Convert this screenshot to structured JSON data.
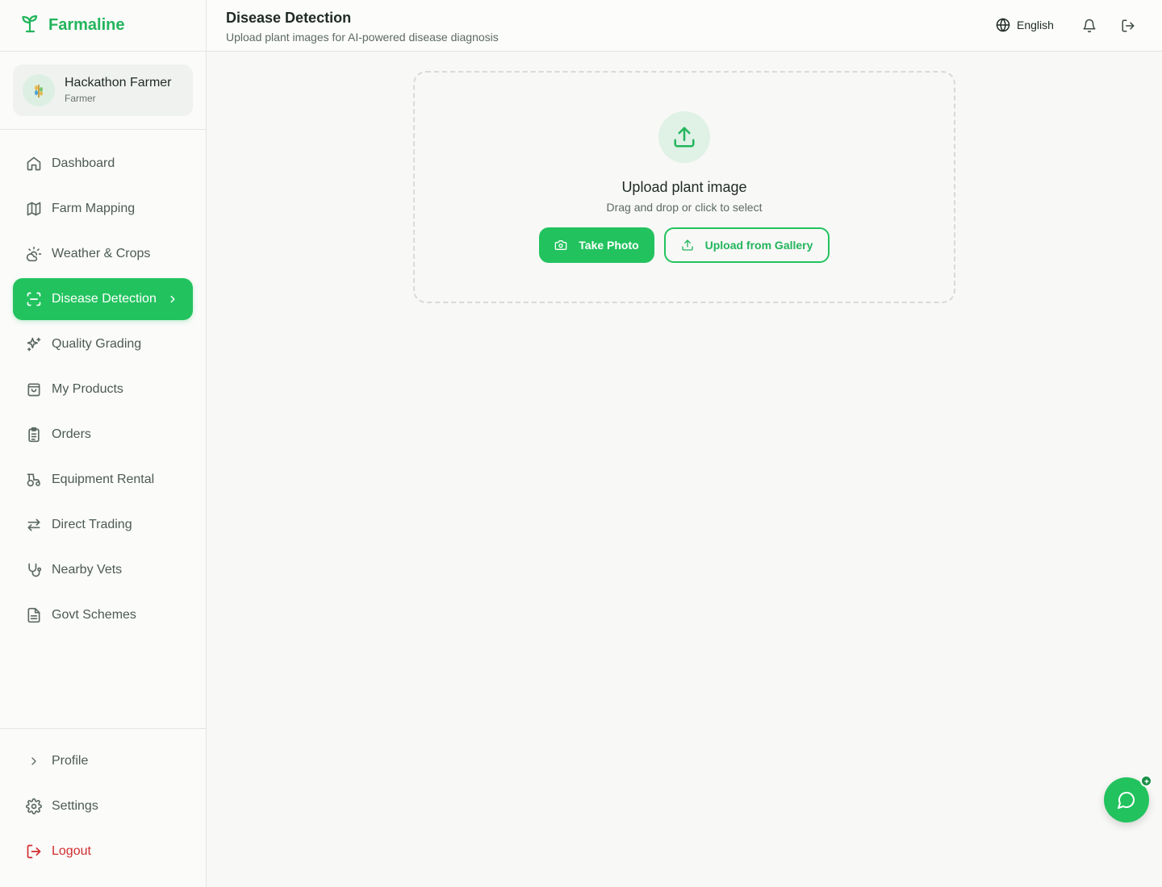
{
  "app": {
    "name": "Farmaline"
  },
  "user": {
    "name": "Hackathon Farmer",
    "role": "Farmer"
  },
  "nav": {
    "items": [
      {
        "label": "Dashboard",
        "icon": "home-icon"
      },
      {
        "label": "Farm Mapping",
        "icon": "map-icon"
      },
      {
        "label": "Weather & Crops",
        "icon": "sun-cloud-icon"
      },
      {
        "label": "Disease Detection",
        "icon": "scan-icon",
        "active": true
      },
      {
        "label": "Quality Grading",
        "icon": "sparkles-icon"
      },
      {
        "label": "My Products",
        "icon": "shopping-bag-icon"
      },
      {
        "label": "Orders",
        "icon": "clipboard-icon"
      },
      {
        "label": "Equipment Rental",
        "icon": "tractor-icon"
      },
      {
        "label": "Direct Trading",
        "icon": "arrows-swap-icon"
      },
      {
        "label": "Nearby Vets",
        "icon": "stethoscope-icon"
      },
      {
        "label": "Govt Schemes",
        "icon": "document-icon"
      }
    ],
    "bottom": [
      {
        "label": "Profile",
        "icon": "chevron-right-icon"
      },
      {
        "label": "Settings",
        "icon": "gear-icon"
      },
      {
        "label": "Logout",
        "icon": "logout-icon"
      }
    ]
  },
  "header": {
    "title": "Disease Detection",
    "subtitle": "Upload plant images for AI-powered disease diagnosis",
    "language": "English"
  },
  "upload": {
    "title": "Upload plant image",
    "hint": "Drag and drop or click to select",
    "take_photo": "Take Photo",
    "gallery": "Upload from Gallery"
  },
  "colors": {
    "accent": "#22c35e",
    "danger": "#d12e2e",
    "background": "#f8f8f6"
  }
}
